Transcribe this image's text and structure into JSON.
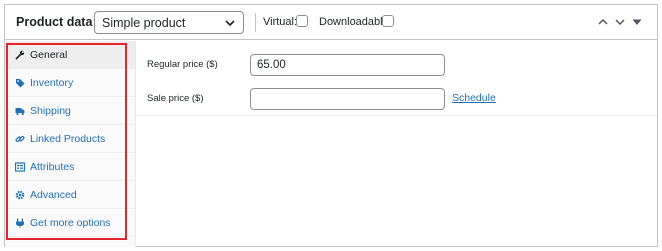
{
  "header": {
    "title": "Product data —",
    "product_type": "Simple product",
    "virtual_label": "Virtual:",
    "downloadable_label": "Downloadable:",
    "virtual_checked": false,
    "downloadable_checked": false
  },
  "tabs": [
    {
      "label": "General",
      "icon": "wrench-icon",
      "active": true
    },
    {
      "label": "Inventory",
      "icon": "tag-icon",
      "active": false
    },
    {
      "label": "Shipping",
      "icon": "truck-icon",
      "active": false
    },
    {
      "label": "Linked Products",
      "icon": "link-icon",
      "active": false
    },
    {
      "label": "Attributes",
      "icon": "list-icon",
      "active": false
    },
    {
      "label": "Advanced",
      "icon": "gear-icon",
      "active": false
    },
    {
      "label": "Get more options",
      "icon": "plugin-icon",
      "active": false
    }
  ],
  "fields": {
    "regular_price_label": "Regular price ($)",
    "regular_price_value": "65.00",
    "sale_price_label": "Sale price ($)",
    "sale_price_value": "",
    "schedule_link": "Schedule"
  },
  "colors": {
    "link": "#2271b1",
    "highlight": "#e2262c",
    "border": "#c3c4c7"
  }
}
